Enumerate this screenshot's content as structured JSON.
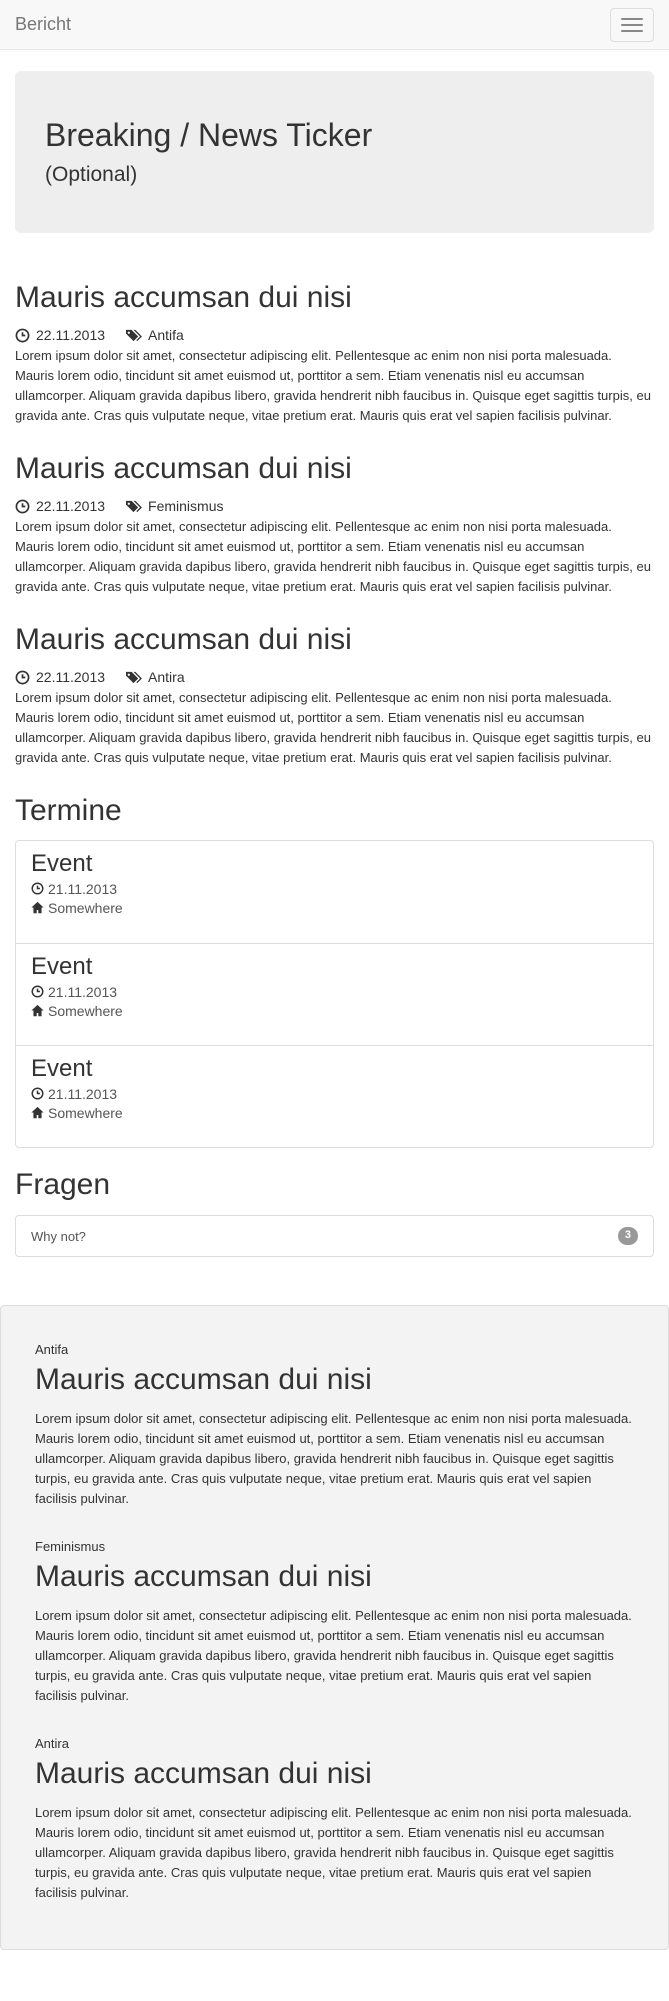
{
  "navbar": {
    "brand": "Bericht"
  },
  "jumbotron": {
    "title": "Breaking / News Ticker",
    "subtitle": "(Optional)"
  },
  "posts": [
    {
      "title": "Mauris accumsan dui nisi",
      "date": "22.11.2013",
      "tag": "Antifa",
      "body": "Lorem ipsum dolor sit amet, consectetur adipiscing elit. Pellentesque ac enim non nisi porta malesuada. Mauris lorem odio, tincidunt sit amet euismod ut, porttitor a sem. Etiam venenatis nisl eu accumsan ullamcorper. Aliquam gravida dapibus libero, gravida hendrerit nibh faucibus in. Quisque eget sagittis turpis, eu gravida ante. Cras quis vulputate neque, vitae pretium erat. Mauris quis erat vel sapien facilisis pulvinar."
    },
    {
      "title": "Mauris accumsan dui nisi",
      "date": "22.11.2013",
      "tag": "Feminismus",
      "body": "Lorem ipsum dolor sit amet, consectetur adipiscing elit. Pellentesque ac enim non nisi porta malesuada. Mauris lorem odio, tincidunt sit amet euismod ut, porttitor a sem. Etiam venenatis nisl eu accumsan ullamcorper. Aliquam gravida dapibus libero, gravida hendrerit nibh faucibus in. Quisque eget sagittis turpis, eu gravida ante. Cras quis vulputate neque, vitae pretium erat. Mauris quis erat vel sapien facilisis pulvinar."
    },
    {
      "title": "Mauris accumsan dui nisi",
      "date": "22.11.2013",
      "tag": "Antira",
      "body": "Lorem ipsum dolor sit amet, consectetur adipiscing elit. Pellentesque ac enim non nisi porta malesuada. Mauris lorem odio, tincidunt sit amet euismod ut, porttitor a sem. Etiam venenatis nisl eu accumsan ullamcorper. Aliquam gravida dapibus libero, gravida hendrerit nibh faucibus in. Quisque eget sagittis turpis, eu gravida ante. Cras quis vulputate neque, vitae pretium erat. Mauris quis erat vel sapien facilisis pulvinar."
    }
  ],
  "termine": {
    "title": "Termine",
    "events": [
      {
        "title": "Event",
        "date": "21.11.2013",
        "place": "Somewhere"
      },
      {
        "title": "Event",
        "date": "21.11.2013",
        "place": "Somewhere"
      },
      {
        "title": "Event",
        "date": "21.11.2013",
        "place": "Somewhere"
      }
    ]
  },
  "fragen": {
    "title": "Fragen",
    "items": [
      {
        "question": "Why not?",
        "count": "3"
      }
    ]
  },
  "featured": [
    {
      "label": "Antifa",
      "title": "Mauris accumsan dui nisi",
      "body": "Lorem ipsum dolor sit amet, consectetur adipiscing elit. Pellentesque ac enim non nisi porta malesuada. Mauris lorem odio, tincidunt sit amet euismod ut, porttitor a sem. Etiam venenatis nisl eu accumsan ullamcorper. Aliquam gravida dapibus libero, gravida hendrerit nibh faucibus in. Quisque eget sagittis turpis, eu gravida ante. Cras quis vulputate neque, vitae pretium erat. Mauris quis erat vel sapien facilisis pulvinar."
    },
    {
      "label": "Feminismus",
      "title": "Mauris accumsan dui nisi",
      "body": "Lorem ipsum dolor sit amet, consectetur adipiscing elit. Pellentesque ac enim non nisi porta malesuada. Mauris lorem odio, tincidunt sit amet euismod ut, porttitor a sem. Etiam venenatis nisl eu accumsan ullamcorper. Aliquam gravida dapibus libero, gravida hendrerit nibh faucibus in. Quisque eget sagittis turpis, eu gravida ante. Cras quis vulputate neque, vitae pretium erat. Mauris quis erat vel sapien facilisis pulvinar."
    },
    {
      "label": "Antira",
      "title": "Mauris accumsan dui nisi",
      "body": "Lorem ipsum dolor sit amet, consectetur adipiscing elit. Pellentesque ac enim non nisi porta malesuada. Mauris lorem odio, tincidunt sit amet euismod ut, porttitor a sem. Etiam venenatis nisl eu accumsan ullamcorper. Aliquam gravida dapibus libero, gravida hendrerit nibh faucibus in. Quisque eget sagittis turpis, eu gravida ante. Cras quis vulputate neque, vitae pretium erat. Mauris quis erat vel sapien facilisis pulvinar."
    }
  ],
  "icons": {
    "date": "clock-icon",
    "tag": "tags-icon",
    "place": "home-icon",
    "menu": "hamburger-icon"
  },
  "colors": {
    "navbar_bg": "#f8f8f8",
    "jumbotron_bg": "#eeeeee",
    "badge": "#999999",
    "footer_bg": "#f3f3f3"
  }
}
